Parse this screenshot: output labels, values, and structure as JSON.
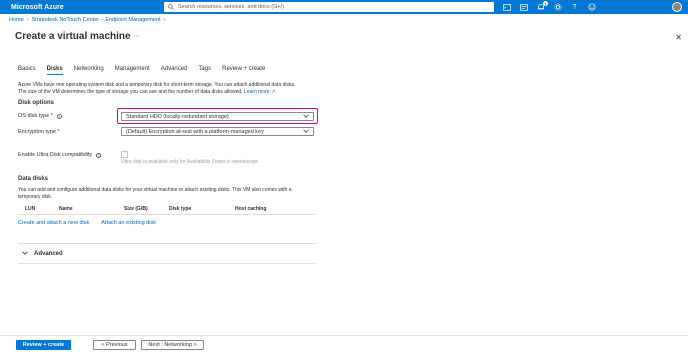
{
  "topbar": {
    "brand": "Microsoft Azure",
    "search_placeholder": "Search resources, services, and docs (G+/)",
    "notification_count": "1"
  },
  "breadcrumb": [
    "Home",
    "Stratodesk NoTouch Center – Endpoint Management"
  ],
  "page": {
    "title": "Create a virtual machine",
    "more": "···",
    "close": "✕"
  },
  "tabs": [
    "Basics",
    "Disks",
    "Networking",
    "Management",
    "Advanced",
    "Tags",
    "Review + create"
  ],
  "description": {
    "line1": "Azure VMs have one operating system disk and a temporary disk for short-term storage. You can attach additional data disks.",
    "line2": "The size of the VM determines the type of storage you can use and the number of data disks allowed.",
    "learn_more": "Learn more"
  },
  "disk_options": {
    "heading": "Disk options",
    "os_disk_type_label": "OS disk type *",
    "os_disk_type_value": "Standard HDD (locally-redundant storage)",
    "encryption_label": "Encryption type *",
    "encryption_value": "(Default) Encryption at-rest with a platform-managed key",
    "ultra_label": "Enable Ultra Disk compatibility",
    "ultra_note": "Ultra disk is available only for Availability Zones in westeurope."
  },
  "data_disks": {
    "heading": "Data disks",
    "desc_line1": "You can add and configure additional data disks for your virtual machine or attach existing disks. This VM also comes with a",
    "desc_line2": "temporary disk.",
    "columns": [
      "LUN",
      "Name",
      "Size (GiB)",
      "Disk type",
      "Host caching"
    ],
    "create_link": "Create and attach a new disk",
    "attach_link": "Attach an existing disk"
  },
  "advanced": {
    "label": "Advanced"
  },
  "footer": {
    "review_create": "Review + create",
    "previous": "< Previous",
    "next": "Next : Networking >"
  },
  "colors": {
    "accent": "#0078d4",
    "highlight": "#e3008c",
    "link": "#0067b8"
  }
}
